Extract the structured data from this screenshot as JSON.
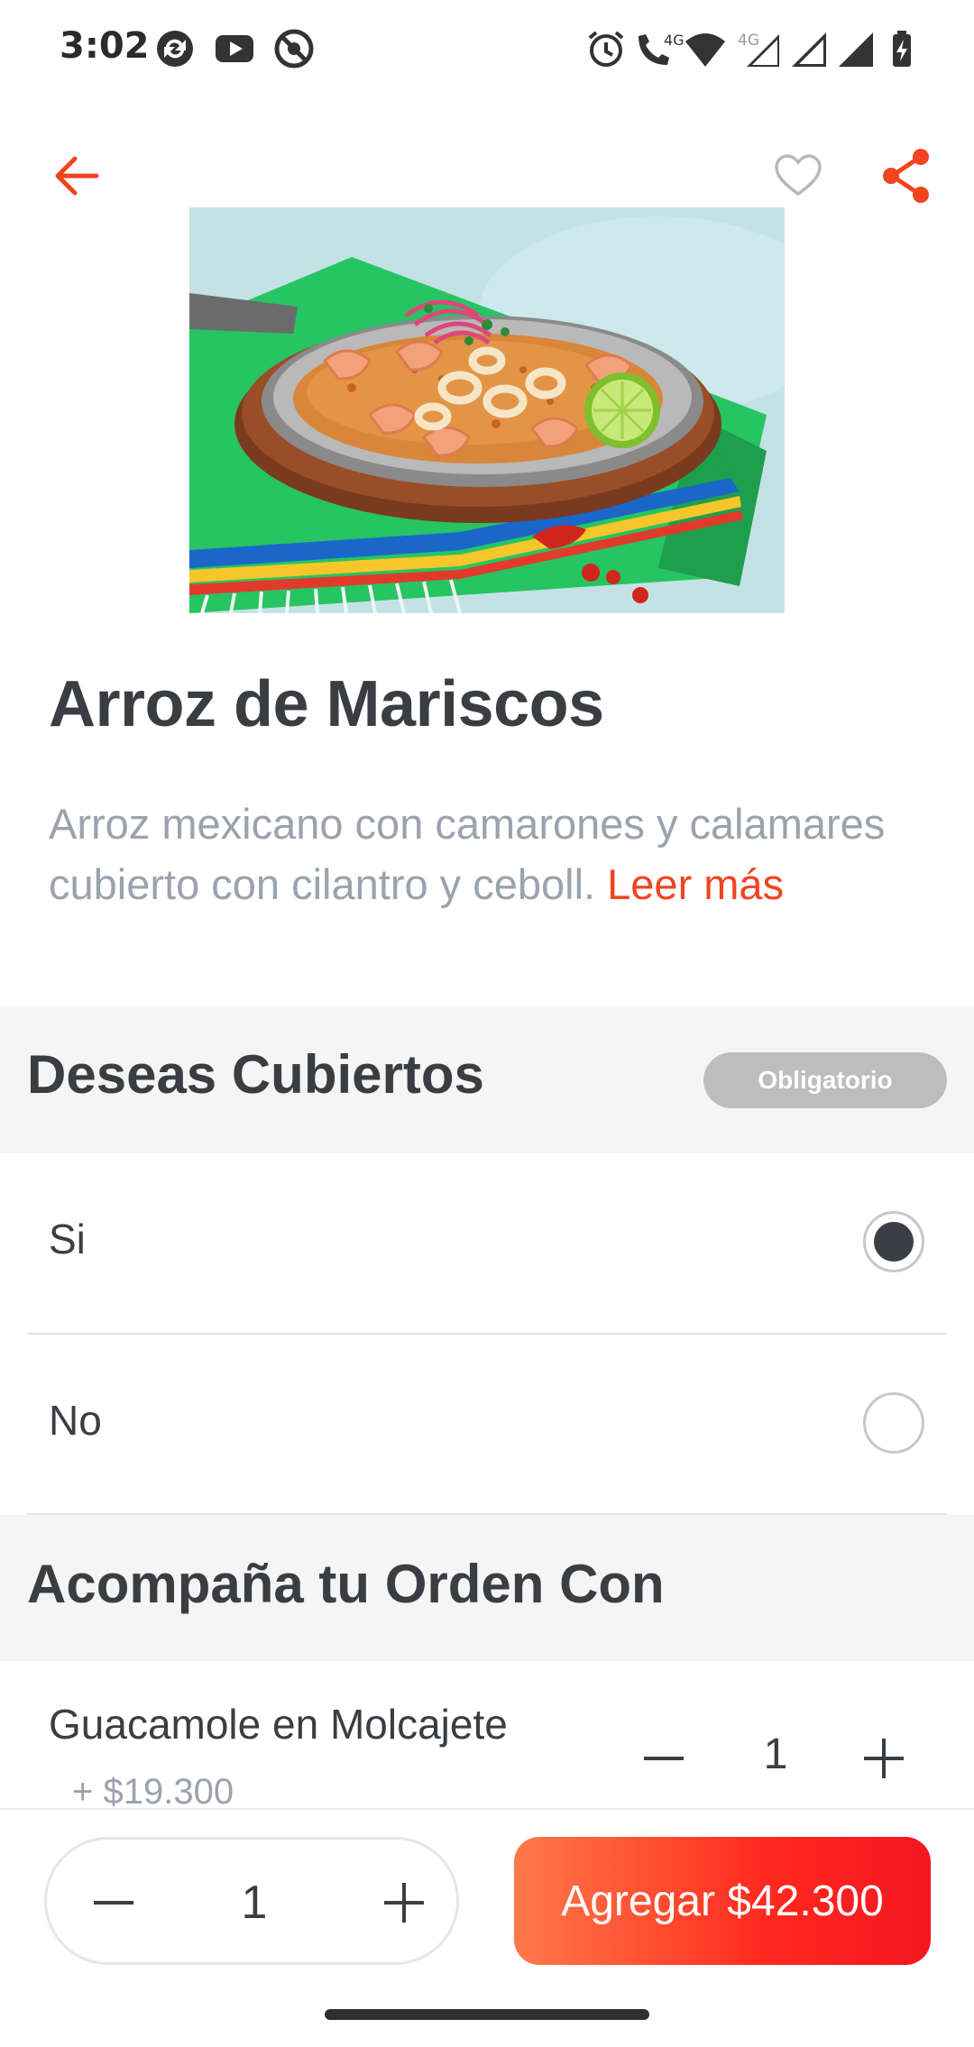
{
  "status_bar": {
    "time": "3:02",
    "left_icons": [
      "sync-icon",
      "youtube-icon",
      "dnd-icon"
    ],
    "right_icons": [
      "alarm-icon",
      "volte-icon",
      "wifi-icon",
      "signal-4g-icon",
      "signal-icon",
      "signal-icon-2",
      "battery-charging-icon"
    ],
    "volte_label": "4G",
    "network_label": "4G"
  },
  "top_bar": {
    "back_icon": "arrow-left-icon",
    "favorite_icon": "heart-outline-icon",
    "share_icon": "share-icon",
    "accent_color": "#f0451f"
  },
  "product": {
    "name": "Arroz de Mariscos",
    "description": "Arroz mexicano con camarones y calamares cubierto con cilantro y ceboll.",
    "read_more": "Leer más"
  },
  "sections": [
    {
      "title": "Deseas Cubiertos",
      "badge": "Obligatorio",
      "options": [
        {
          "label": "Si",
          "selected": true
        },
        {
          "label": "No",
          "selected": false
        }
      ]
    },
    {
      "title": "Acompaña tu Orden Con",
      "addons": [
        {
          "name": "Guacamole en Molcajete",
          "price": "+ $19.300",
          "quantity": "1"
        }
      ]
    }
  ],
  "footer": {
    "quantity": "1",
    "add_button": "Agregar $42.300"
  }
}
